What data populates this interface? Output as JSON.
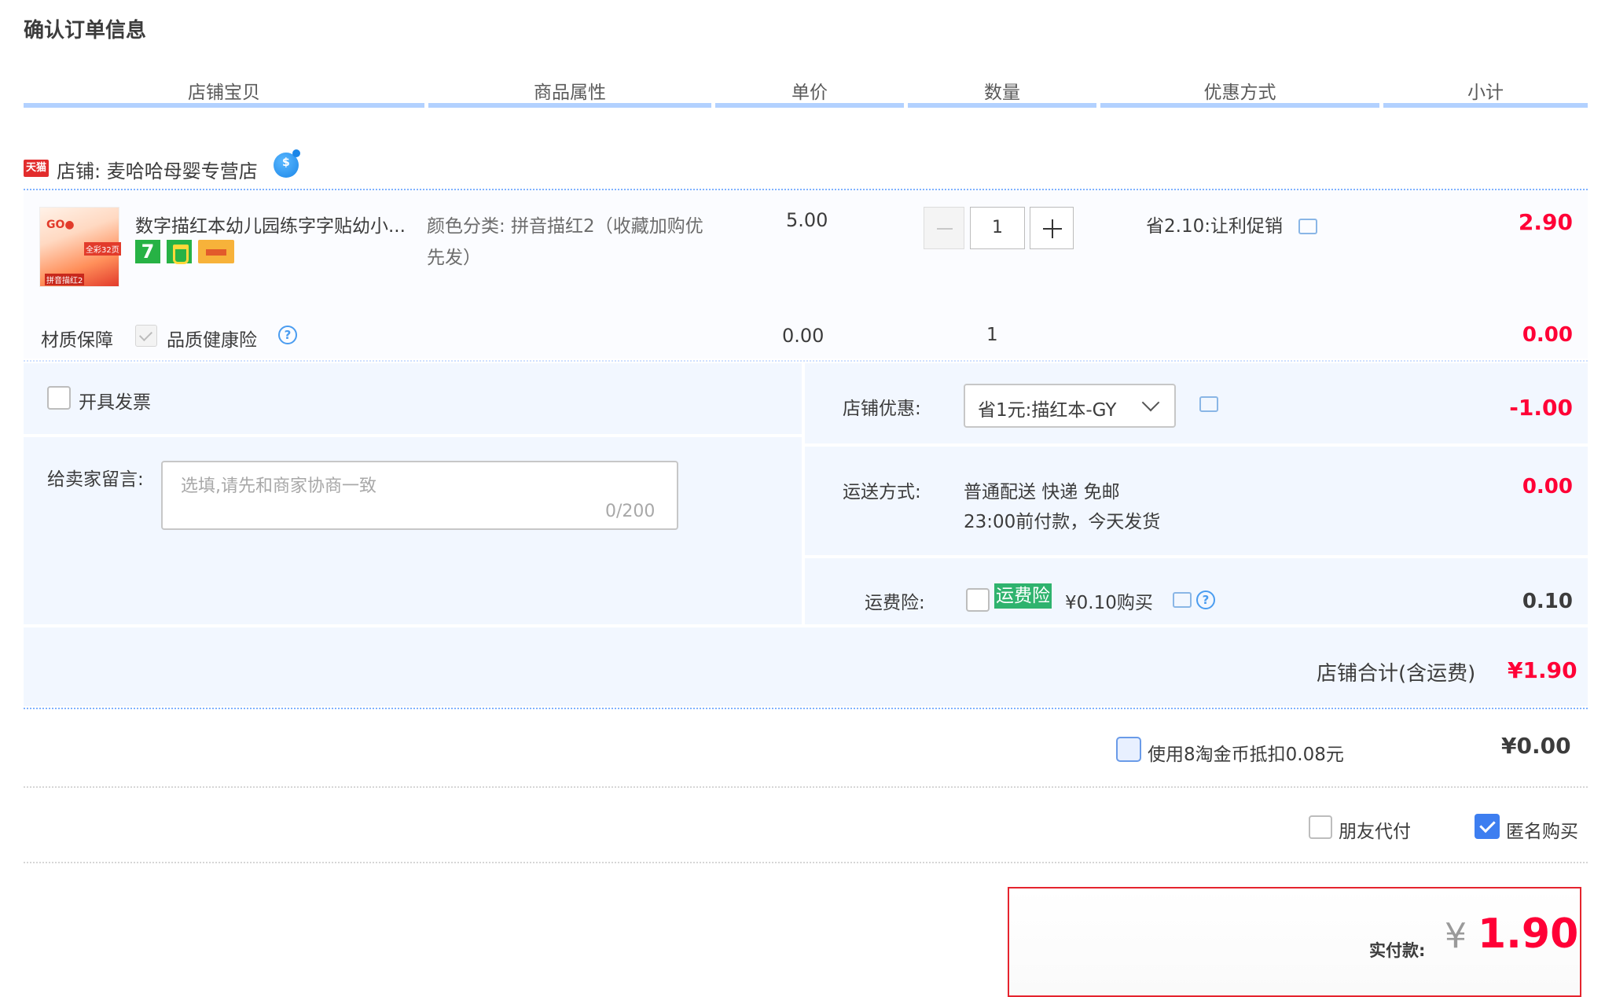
{
  "page": {
    "title": "确认订单信息"
  },
  "columns": [
    "店铺宝贝",
    "商品属性",
    "单价",
    "数量",
    "优惠方式",
    "小计"
  ],
  "shop": {
    "badge": "天猫",
    "name": "店铺: 麦哈哈母婴专营店"
  },
  "item": {
    "thumb_text": [
      "GO●",
      "全彩32页",
      "拼音描红2"
    ],
    "title": "数字描红本幼儿园练字字贴幼小...",
    "badge_number": "7",
    "attribute": "颜色分类: 拼音描红2（收藏加购优先发）",
    "price": "5.00",
    "quantity": "1",
    "promo": "省2.10:让利促销",
    "subtotal": "2.90"
  },
  "insurance": {
    "label": "材质保障",
    "name": "品质健康险",
    "help": "?",
    "price": "0.00",
    "quantity": "1",
    "subtotal": "0.00"
  },
  "invoice": {
    "label": "开具发票"
  },
  "message": {
    "label": "给卖家留言:",
    "placeholder": "选填,请先和商家协商一致",
    "count": "0/200"
  },
  "store_discount": {
    "label": "店铺优惠:",
    "selected": "省1元:描红本-GY",
    "value": "-1.00"
  },
  "shipping": {
    "label": "运送方式:",
    "line1": "普通配送 快递 免邮",
    "line2": "23:00前付款，今天发货",
    "value": "0.00"
  },
  "shipping_insurance": {
    "label": "运费险:",
    "tag": "运费险",
    "text": "¥0.10购买",
    "value": "0.10"
  },
  "store_total": {
    "label": "店铺合计(含运费)",
    "value": "¥1.90"
  },
  "coins": {
    "label": "使用8淘金币抵扣0.08元",
    "value": "¥0.00"
  },
  "options": {
    "friend_pay": "朋友代付",
    "anonymous": "匿名购买"
  },
  "payment": {
    "label": "实付款:",
    "currency": "¥",
    "amount": "1.90"
  },
  "colors": {
    "accent_red": "#ff0036",
    "header_line": "#b2d1ff",
    "panel_bg": "#f2f7ff",
    "check_blue": "#3d7ef0",
    "green_tag": "#2fb36e"
  }
}
